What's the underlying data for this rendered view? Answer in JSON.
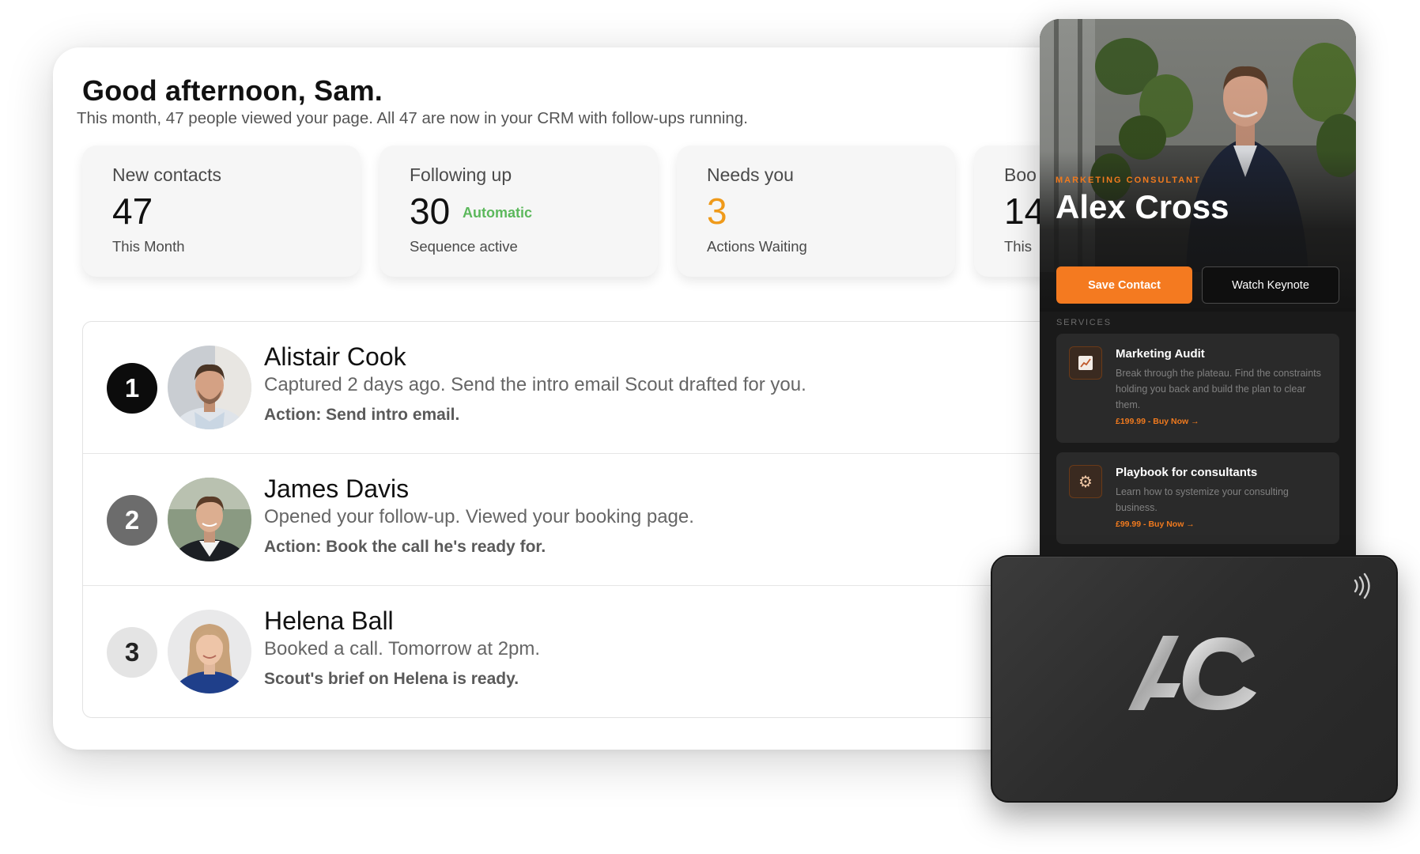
{
  "dashboard": {
    "greeting": "Good afternoon, Sam.",
    "subtitle": "This month, 47 people viewed your page. All 47 are now in your CRM with follow-ups running.",
    "stats": [
      {
        "label": "New contacts",
        "value": "47",
        "caption": "This Month"
      },
      {
        "label": "Following up",
        "value": "30",
        "tag": "Automatic",
        "caption": "Sequence active"
      },
      {
        "label": "Needs you",
        "value": "3",
        "caption": "Actions Waiting"
      },
      {
        "label": "Boo",
        "value": "14",
        "caption": "This"
      }
    ],
    "actions": [
      {
        "number": "1",
        "name": "Alistair Cook",
        "description": "Captured 2 days ago. Send the intro email Scout drafted for you.",
        "action": "Action: Send intro email."
      },
      {
        "number": "2",
        "name": "James Davis",
        "description": "Opened your follow-up. Viewed your booking page.",
        "action": "Action: Book the call he's ready for."
      },
      {
        "number": "3",
        "name": "Helena Ball",
        "description": "Booked a call. Tomorrow at 2pm.",
        "action": "Scout's brief on Helena is ready."
      }
    ]
  },
  "profile": {
    "role": "MARKETING CONSULTANT",
    "name": "Alex Cross",
    "save_label": "Save Contact",
    "watch_label": "Watch Keynote",
    "services_label": "SERVICES",
    "services": [
      {
        "icon": "chart-icon",
        "title": "Marketing Audit",
        "description": "Break through the plateau. Find the constraints holding you back and build the plan to clear them.",
        "price": "£199.99 - Buy Now →"
      },
      {
        "icon": "gear-icon",
        "title": "Playbook for consultants",
        "description": "Learn how to systemize your consulting business.",
        "price": "£99.99 - Buy Now →"
      }
    ]
  },
  "nfc_card": {
    "logo": "AC",
    "icon": "contactless-icon"
  },
  "colors": {
    "accent_orange": "#f47a20",
    "needs_you_orange": "#ef9a1a",
    "automatic_green": "#5cb85c"
  }
}
